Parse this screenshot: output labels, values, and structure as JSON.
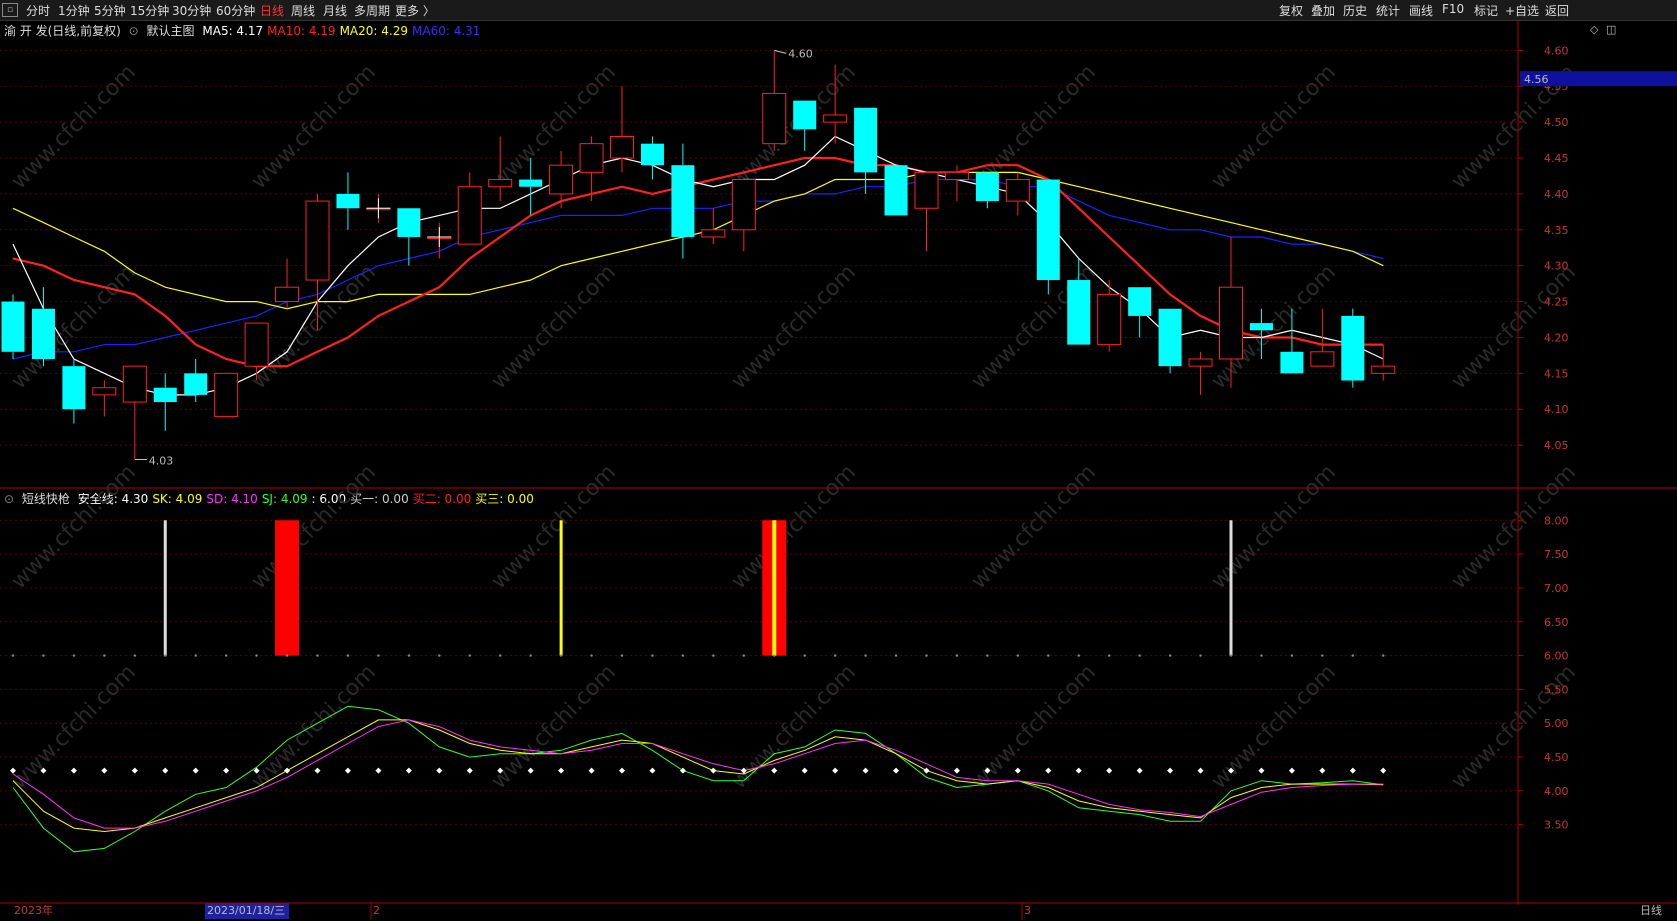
{
  "toolbar": {
    "periods": [
      "分时",
      "1分钟",
      "5分钟",
      "15分钟",
      "30分钟",
      "60分钟",
      "日线",
      "周线",
      "月线",
      "多周期",
      "更多 〉"
    ],
    "active_period": "日线",
    "right_buttons": [
      "复权",
      "叠加",
      "历史",
      "统计",
      "画线",
      "F10",
      "标记",
      "+自选",
      "返回"
    ]
  },
  "main_legend": {
    "stock": "渝 开 发(日线,前复权)",
    "indicator": "默认主图",
    "items": [
      {
        "label": "MA5: 4.17",
        "color": "#ffffff"
      },
      {
        "label": "MA10: 4.19",
        "color": "#ff2020"
      },
      {
        "label": "MA20: 4.29",
        "color": "#ffff00"
      },
      {
        "label": "MA60: 4.31",
        "color": "#3030ff"
      }
    ]
  },
  "sub_legend": {
    "indicator": "短线快枪",
    "items": [
      {
        "label": "安全线: 4.30",
        "color": "#ffffff"
      },
      {
        "label": "SK: 4.09",
        "color": "#ffff00"
      },
      {
        "label": "SD: 4.10",
        "color": "#ff30ff"
      },
      {
        "label": "SJ: 4.09",
        "color": "#30ff30"
      },
      {
        "label": ": 6.00",
        "color": "#ffffff"
      },
      {
        "label": "买一: 0.00",
        "color": "#cccccc"
      },
      {
        "label": "买二: 0.00",
        "color": "#ff2020"
      },
      {
        "label": "买三: 0.00",
        "color": "#ffff00"
      }
    ]
  },
  "price_axis": {
    "labels": [
      "4.60",
      "4.55",
      "4.50",
      "4.45",
      "4.40",
      "4.35",
      "4.30",
      "4.25",
      "4.20",
      "4.15",
      "4.10",
      "4.05"
    ],
    "current_price": "4.56"
  },
  "sub_axis": {
    "labels": [
      "8.00",
      "7.50",
      "7.00",
      "6.50",
      "6.00",
      "5.50",
      "5.00",
      "4.50",
      "4.00",
      "3.50"
    ]
  },
  "annotations": {
    "high": "4.60",
    "low": "4.03"
  },
  "date_axis": {
    "year": "2023年",
    "cursor_date": "2023/01/18/三",
    "month2": "2",
    "month3": "3",
    "period_label": "日线"
  },
  "watermark": "www.cfchi.com",
  "colors": {
    "up": "#ff2020",
    "down": "#00ffff",
    "ma5": "#ffffff",
    "ma10": "#ff2020",
    "ma20": "#ffff00",
    "ma60": "#2020ff"
  },
  "chart_data": {
    "type": "candlestick",
    "candles": [
      {
        "o": 4.25,
        "h": 4.26,
        "l": 4.17,
        "c": 4.18
      },
      {
        "o": 4.24,
        "h": 4.27,
        "l": 4.16,
        "c": 4.17
      },
      {
        "o": 4.16,
        "h": 4.17,
        "l": 4.08,
        "c": 4.1
      },
      {
        "o": 4.12,
        "h": 4.14,
        "l": 4.09,
        "c": 4.13
      },
      {
        "o": 4.11,
        "h": 4.16,
        "l": 4.03,
        "c": 4.16
      },
      {
        "o": 4.13,
        "h": 4.15,
        "l": 4.07,
        "c": 4.11
      },
      {
        "o": 4.15,
        "h": 4.17,
        "l": 4.11,
        "c": 4.12
      },
      {
        "o": 4.09,
        "h": 4.15,
        "l": 4.09,
        "c": 4.15
      },
      {
        "o": 4.16,
        "h": 4.22,
        "l": 4.14,
        "c": 4.22
      },
      {
        "o": 4.25,
        "h": 4.31,
        "l": 4.24,
        "c": 4.27
      },
      {
        "o": 4.28,
        "h": 4.4,
        "l": 4.21,
        "c": 4.39
      },
      {
        "o": 4.4,
        "h": 4.43,
        "l": 4.35,
        "c": 4.38
      },
      {
        "o": 4.38,
        "h": 4.4,
        "l": 4.36,
        "c": 4.38
      },
      {
        "o": 4.38,
        "h": 4.38,
        "l": 4.3,
        "c": 4.34
      },
      {
        "o": 4.34,
        "h": 4.36,
        "l": 4.31,
        "c": 4.34
      },
      {
        "o": 4.33,
        "h": 4.43,
        "l": 4.33,
        "c": 4.41
      },
      {
        "o": 4.41,
        "h": 4.48,
        "l": 4.39,
        "c": 4.42
      },
      {
        "o": 4.42,
        "h": 4.45,
        "l": 4.37,
        "c": 4.41
      },
      {
        "o": 4.4,
        "h": 4.46,
        "l": 4.38,
        "c": 4.44
      },
      {
        "o": 4.43,
        "h": 4.48,
        "l": 4.39,
        "c": 4.47
      },
      {
        "o": 4.45,
        "h": 4.55,
        "l": 4.43,
        "c": 4.48
      },
      {
        "o": 4.47,
        "h": 4.48,
        "l": 4.42,
        "c": 4.44
      },
      {
        "o": 4.44,
        "h": 4.47,
        "l": 4.31,
        "c": 4.34
      },
      {
        "o": 4.34,
        "h": 4.38,
        "l": 4.33,
        "c": 4.35
      },
      {
        "o": 4.35,
        "h": 4.42,
        "l": 4.32,
        "c": 4.42
      },
      {
        "o": 4.47,
        "h": 4.6,
        "l": 4.46,
        "c": 4.54
      },
      {
        "o": 4.53,
        "h": 4.53,
        "l": 4.46,
        "c": 4.49
      },
      {
        "o": 4.5,
        "h": 4.58,
        "l": 4.47,
        "c": 4.51
      },
      {
        "o": 4.52,
        "h": 4.52,
        "l": 4.4,
        "c": 4.43
      },
      {
        "o": 4.44,
        "h": 4.44,
        "l": 4.37,
        "c": 4.37
      },
      {
        "o": 4.38,
        "h": 4.43,
        "l": 4.32,
        "c": 4.43
      },
      {
        "o": 4.42,
        "h": 4.44,
        "l": 4.39,
        "c": 4.43
      },
      {
        "o": 4.43,
        "h": 4.43,
        "l": 4.38,
        "c": 4.39
      },
      {
        "o": 4.39,
        "h": 4.43,
        "l": 4.37,
        "c": 4.42
      },
      {
        "o": 4.42,
        "h": 4.42,
        "l": 4.26,
        "c": 4.28
      },
      {
        "o": 4.28,
        "h": 4.31,
        "l": 4.19,
        "c": 4.19
      },
      {
        "o": 4.19,
        "h": 4.28,
        "l": 4.18,
        "c": 4.26
      },
      {
        "o": 4.27,
        "h": 4.27,
        "l": 4.2,
        "c": 4.23
      },
      {
        "o": 4.24,
        "h": 4.24,
        "l": 4.15,
        "c": 4.16
      },
      {
        "o": 4.16,
        "h": 4.18,
        "l": 4.12,
        "c": 4.17
      },
      {
        "o": 4.17,
        "h": 4.34,
        "l": 4.13,
        "c": 4.27
      },
      {
        "o": 4.22,
        "h": 4.24,
        "l": 4.17,
        "c": 4.21
      },
      {
        "o": 4.18,
        "h": 4.24,
        "l": 4.15,
        "c": 4.15
      },
      {
        "o": 4.16,
        "h": 4.24,
        "l": 4.16,
        "c": 4.18
      },
      {
        "o": 4.23,
        "h": 4.24,
        "l": 4.13,
        "c": 4.14
      },
      {
        "o": 4.15,
        "h": 4.19,
        "l": 4.14,
        "c": 4.16
      }
    ],
    "ma5": [
      4.33,
      4.24,
      4.17,
      4.15,
      4.13,
      4.12,
      4.12,
      4.13,
      4.15,
      4.18,
      4.25,
      4.3,
      4.34,
      4.36,
      4.37,
      4.38,
      4.38,
      4.4,
      4.42,
      4.44,
      4.45,
      4.44,
      4.42,
      4.41,
      4.42,
      4.42,
      4.44,
      4.48,
      4.46,
      4.44,
      4.43,
      4.42,
      4.41,
      4.4,
      4.36,
      4.31,
      4.27,
      4.24,
      4.2,
      4.21,
      4.2,
      4.2,
      4.21,
      4.2,
      4.19,
      4.17
    ],
    "ma10": [
      4.31,
      4.3,
      4.28,
      4.27,
      4.26,
      4.23,
      4.19,
      4.17,
      4.16,
      4.16,
      4.18,
      4.2,
      4.23,
      4.25,
      4.27,
      4.31,
      4.34,
      4.37,
      4.39,
      4.4,
      4.41,
      4.4,
      4.41,
      4.42,
      4.43,
      4.44,
      4.45,
      4.45,
      4.44,
      4.44,
      4.43,
      4.43,
      4.44,
      4.44,
      4.42,
      4.38,
      4.34,
      4.3,
      4.26,
      4.23,
      4.21,
      4.2,
      4.2,
      4.19,
      4.19,
      4.19
    ],
    "ma20": [
      4.38,
      4.36,
      4.34,
      4.32,
      4.29,
      4.27,
      4.26,
      4.25,
      4.25,
      4.24,
      4.25,
      4.25,
      4.26,
      4.26,
      4.26,
      4.26,
      4.27,
      4.28,
      4.3,
      4.31,
      4.32,
      4.33,
      4.34,
      4.35,
      4.37,
      4.39,
      4.4,
      4.42,
      4.42,
      4.42,
      4.43,
      4.43,
      4.43,
      4.43,
      4.42,
      4.41,
      4.4,
      4.39,
      4.38,
      4.37,
      4.36,
      4.35,
      4.34,
      4.33,
      4.32,
      4.3
    ],
    "ma60": [
      4.17,
      4.18,
      4.18,
      4.19,
      4.19,
      4.2,
      4.21,
      4.22,
      4.23,
      4.25,
      4.26,
      4.28,
      4.3,
      4.31,
      4.32,
      4.34,
      4.35,
      4.36,
      4.37,
      4.37,
      4.37,
      4.38,
      4.38,
      4.38,
      4.39,
      4.39,
      4.4,
      4.4,
      4.41,
      4.41,
      4.42,
      4.42,
      4.42,
      4.41,
      4.41,
      4.39,
      4.37,
      4.36,
      4.35,
      4.35,
      4.34,
      4.34,
      4.33,
      4.33,
      4.32,
      4.31
    ],
    "sub": {
      "safety_line": 4.3,
      "sk": [
        4.15,
        3.7,
        3.45,
        3.4,
        3.45,
        3.6,
        3.75,
        3.9,
        4.05,
        4.3,
        4.55,
        4.8,
        5.05,
        5.05,
        4.9,
        4.7,
        4.6,
        4.55,
        4.55,
        4.65,
        4.75,
        4.7,
        4.5,
        4.3,
        4.25,
        4.45,
        4.6,
        4.8,
        4.75,
        4.55,
        4.3,
        4.15,
        4.1,
        4.15,
        4.05,
        3.85,
        3.75,
        3.7,
        3.65,
        3.6,
        3.9,
        4.05,
        4.1,
        4.1,
        4.1,
        4.09
      ],
      "sd": [
        4.25,
        3.95,
        3.6,
        3.45,
        3.45,
        3.55,
        3.7,
        3.85,
        4.0,
        4.2,
        4.45,
        4.7,
        4.95,
        5.05,
        4.95,
        4.75,
        4.65,
        4.6,
        4.55,
        4.6,
        4.7,
        4.7,
        4.55,
        4.4,
        4.3,
        4.4,
        4.55,
        4.7,
        4.75,
        4.6,
        4.4,
        4.2,
        4.15,
        4.15,
        4.1,
        3.95,
        3.8,
        3.72,
        3.68,
        3.62,
        3.8,
        3.98,
        4.05,
        4.08,
        4.1,
        4.1
      ],
      "sj": [
        4.05,
        3.45,
        3.1,
        3.15,
        3.4,
        3.7,
        3.95,
        4.05,
        4.35,
        4.75,
        5.0,
        5.25,
        5.2,
        5.0,
        4.65,
        4.5,
        4.55,
        4.55,
        4.6,
        4.75,
        4.85,
        4.6,
        4.3,
        4.15,
        4.15,
        4.55,
        4.65,
        4.9,
        4.85,
        4.55,
        4.2,
        4.05,
        4.1,
        4.15,
        4.0,
        3.75,
        3.7,
        3.65,
        3.55,
        3.55,
        4.0,
        4.15,
        4.1,
        4.12,
        4.15,
        4.09
      ],
      "bars": [
        {
          "idx": 5,
          "color": "#dddddd",
          "kind": "thin"
        },
        {
          "idx": 9,
          "color": "#ff0000",
          "kind": "wide"
        },
        {
          "idx": 18,
          "color": "#ffff00",
          "kind": "thin"
        },
        {
          "idx": 25,
          "color": "#ff0000",
          "kind": "wide",
          "inner": "#ffff00"
        },
        {
          "idx": 40,
          "color": "#dddddd",
          "kind": "thin"
        }
      ],
      "ymin": 3.2,
      "ymax": 8.3
    },
    "price_min": 4.0,
    "price_max": 4.62
  }
}
